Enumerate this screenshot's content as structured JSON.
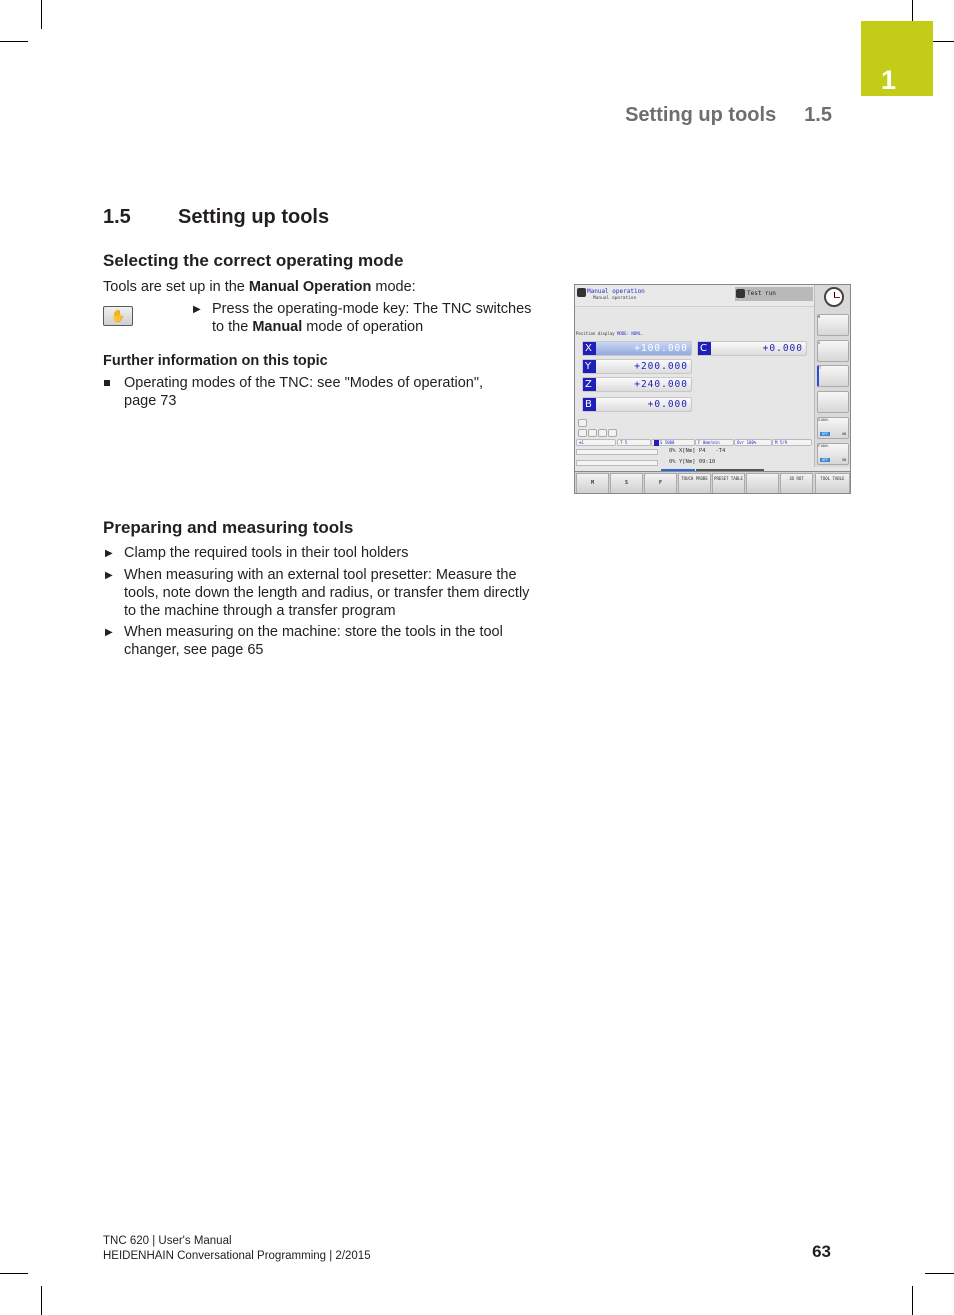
{
  "chapter_tab": {
    "number": "1",
    "color": "#c3cd17"
  },
  "running_head": {
    "title": "Setting up tools",
    "section": "1.5"
  },
  "section": {
    "number": "1.5",
    "title": "Setting up tools"
  },
  "selecting": {
    "heading": "Selecting the correct operating mode",
    "intro_pre": "Tools are set up in the ",
    "intro_bold": "Manual Operation",
    "intro_post": " mode:",
    "key_icon": "hand-icon",
    "step_line1": "Press the operating-mode key: The TNC switches",
    "step_line2_pre": "to the ",
    "step_line2_bold": "Manual",
    "step_line2_post": " mode of operation"
  },
  "further_info": {
    "heading": "Further information on this topic",
    "items": [
      {
        "line1": "Operating modes of the TNC: see \"Modes of operation\",",
        "line2": "page 73"
      }
    ]
  },
  "preparing": {
    "heading": "Preparing and measuring tools",
    "steps": [
      {
        "lines": [
          "Clamp the required tools in their tool holders"
        ]
      },
      {
        "lines": [
          "When measuring with an external tool presetter: Measure the",
          "tools, note down the length and radius, or transfer them directly",
          "to the machine through a transfer program"
        ]
      },
      {
        "lines": [
          "When measuring on the machine: store the tools in the tool",
          "changer, see page 65"
        ]
      }
    ]
  },
  "tnc_screen": {
    "mode_title": "Manual operation",
    "mode_subtitle": "Manual operation",
    "secondary_mode": "Test run",
    "position_display_label": "Position display",
    "position_display_mode": "MODE: NOML.",
    "axes": [
      {
        "axis": "X",
        "value": "+100.000",
        "active": true
      },
      {
        "axis": "Y",
        "value": "+200.000",
        "active": false
      },
      {
        "axis": "Z",
        "value": "+240.000",
        "active": false
      },
      {
        "axis": "B",
        "value": "+0.000",
        "active": false
      },
      {
        "axis": "C",
        "value": "+0.000",
        "active": false
      }
    ],
    "status_bar": [
      "T 5",
      "S 5000",
      "F 0mm/min",
      "Ovr 100%",
      "M 5/9"
    ],
    "status_first": "1",
    "load": [
      {
        "percent": "0%",
        "label": "X[Nm]",
        "info": "P4   -T4"
      },
      {
        "percent": "0%",
        "label": "Y[Nm]",
        "info": "09:10"
      }
    ],
    "overrides": [
      {
        "label": "S100%",
        "off": "OFF",
        "on": "ON"
      },
      {
        "label": "F100%",
        "off": "OFF",
        "on": "ON"
      }
    ],
    "side_buttons": [
      "M",
      "S",
      "T"
    ],
    "softkeys": [
      {
        "label": "M"
      },
      {
        "label": "S"
      },
      {
        "label": "F"
      },
      {
        "label": "TOUCH PROBE"
      },
      {
        "label": "PRESET TABLE"
      },
      {
        "label": ""
      },
      {
        "label": "3D ROT"
      },
      {
        "label": "TOOL TABLE"
      }
    ]
  },
  "footer": {
    "line1": "TNC 620 | User's Manual",
    "line2": "HEIDENHAIN Conversational Programming | 2/2015",
    "page": "63"
  }
}
